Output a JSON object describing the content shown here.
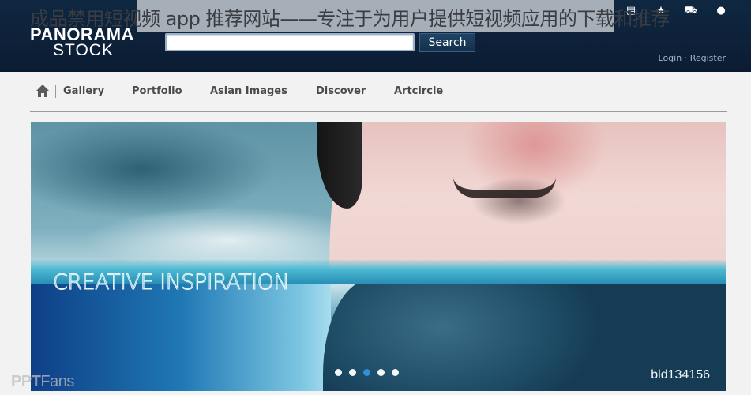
{
  "overlay": {
    "title": "成品禁用短视频 app 推荐网站——专注于为用户提供短视频应用的下载和推荐"
  },
  "header": {
    "logo_line1": "PANORAMA",
    "logo_line2": "STOCK",
    "search": {
      "value": "",
      "placeholder": "",
      "button_label": "Search"
    },
    "auth": {
      "login": "Login",
      "separator": "·",
      "register": "Register"
    },
    "top_icons": [
      {
        "name": "lightbox-icon",
        "glyph": "🗏"
      },
      {
        "name": "favorites-star-icon",
        "glyph": "★"
      },
      {
        "name": "cart-icon",
        "glyph": "⛟"
      },
      {
        "name": "user-icon",
        "glyph": "👤"
      }
    ]
  },
  "nav": {
    "home_icon": "home-icon",
    "items": [
      {
        "label": "Gallery"
      },
      {
        "label": "Portfolio"
      },
      {
        "label": "Asian Images"
      },
      {
        "label": "Discover"
      },
      {
        "label": "Artcircle"
      }
    ]
  },
  "hero": {
    "title": "CREATIVE INSPIRATION",
    "image_id": "bld134156",
    "slides_total": 5,
    "active_slide": 3
  },
  "watermark": {
    "part1": "PPT",
    "part2": "Fans"
  },
  "colors": {
    "header_bg": "#0d2139",
    "active_dot": "#2f8fd8",
    "nav_text": "#4a4a4a"
  }
}
